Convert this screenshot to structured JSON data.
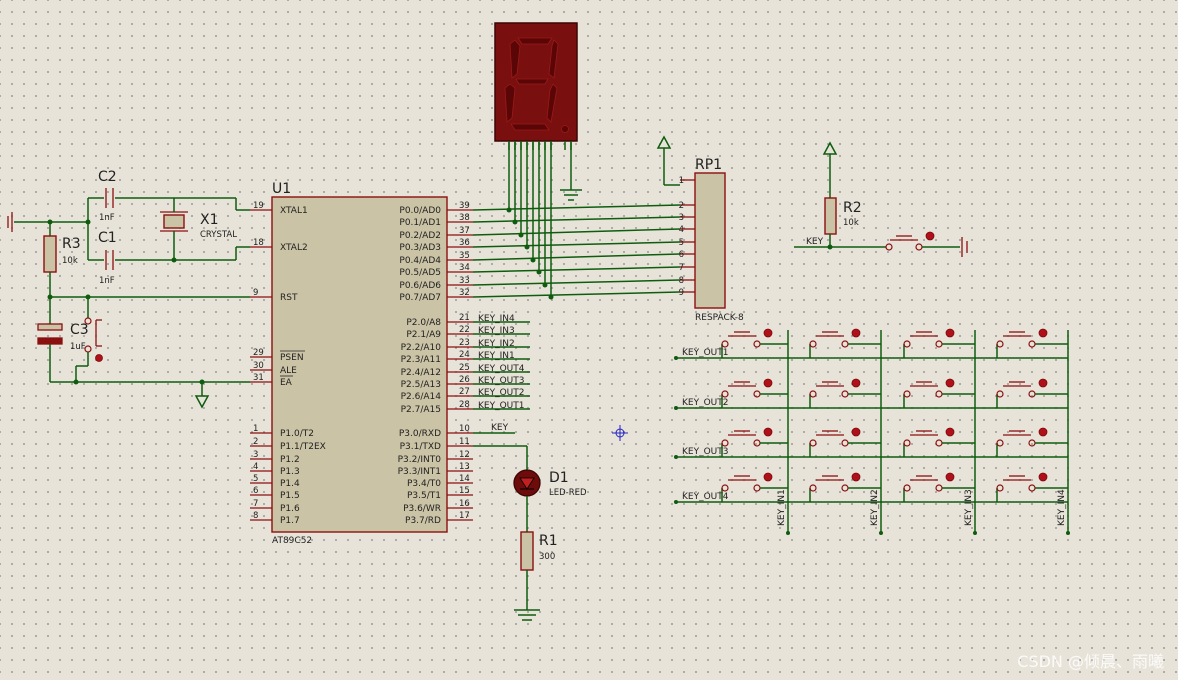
{
  "u1": {
    "ref": "U1",
    "part": "AT89C52",
    "left_pins": [
      {
        "num": "19",
        "name": "XTAL1"
      },
      {
        "num": "18",
        "name": "XTAL2"
      },
      {
        "num": "9",
        "name": "RST"
      },
      {
        "num": "29",
        "name": "PSEN"
      },
      {
        "num": "30",
        "name": "ALE"
      },
      {
        "num": "31",
        "name": "EA"
      },
      {
        "num": "1",
        "name": "P1.0/T2"
      },
      {
        "num": "2",
        "name": "P1.1/T2EX"
      },
      {
        "num": "3",
        "name": "P1.2"
      },
      {
        "num": "4",
        "name": "P1.3"
      },
      {
        "num": "5",
        "name": "P1.4"
      },
      {
        "num": "6",
        "name": "P1.5"
      },
      {
        "num": "7",
        "name": "P1.6"
      },
      {
        "num": "8",
        "name": "P1.7"
      }
    ],
    "right_pins": [
      {
        "num": "39",
        "name": "P0.0/AD0"
      },
      {
        "num": "38",
        "name": "P0.1/AD1"
      },
      {
        "num": "37",
        "name": "P0.2/AD2"
      },
      {
        "num": "36",
        "name": "P0.3/AD3"
      },
      {
        "num": "35",
        "name": "P0.4/AD4"
      },
      {
        "num": "34",
        "name": "P0.5/AD5"
      },
      {
        "num": "33",
        "name": "P0.6/AD6"
      },
      {
        "num": "32",
        "name": "P0.7/AD7"
      },
      {
        "num": "21",
        "name": "P2.0/A8"
      },
      {
        "num": "22",
        "name": "P2.1/A9"
      },
      {
        "num": "23",
        "name": "P2.2/A10"
      },
      {
        "num": "24",
        "name": "P2.3/A11"
      },
      {
        "num": "25",
        "name": "P2.4/A12"
      },
      {
        "num": "26",
        "name": "P2.5/A13"
      },
      {
        "num": "27",
        "name": "P2.6/A14"
      },
      {
        "num": "28",
        "name": "P2.7/A15"
      },
      {
        "num": "10",
        "name": "P3.0/RXD"
      },
      {
        "num": "11",
        "name": "P3.1/TXD"
      },
      {
        "num": "12",
        "name": "P3.2/INT0"
      },
      {
        "num": "13",
        "name": "P3.3/INT1"
      },
      {
        "num": "14",
        "name": "P3.4/T0"
      },
      {
        "num": "15",
        "name": "P3.5/T1"
      },
      {
        "num": "16",
        "name": "P3.6/WR"
      },
      {
        "num": "17",
        "name": "P3.7/RD"
      }
    ],
    "p2_nets": [
      "KEY_IN4",
      "KEY_IN3",
      "KEY_IN2",
      "KEY_IN1",
      "KEY_OUT4",
      "KEY_OUT3",
      "KEY_OUT2",
      "KEY_OUT1"
    ],
    "p3_net": "KEY"
  },
  "c2": {
    "ref": "C2",
    "value": "1nF"
  },
  "c1": {
    "ref": "C1",
    "value": "1nF"
  },
  "x1": {
    "ref": "X1",
    "value": "CRYSTAL"
  },
  "r3": {
    "ref": "R3",
    "value": "10k"
  },
  "c3": {
    "ref": "C3",
    "value": "1uF"
  },
  "rp1": {
    "ref": "RP1",
    "part": "RESPACK-8",
    "pins": [
      "1",
      "2",
      "3",
      "4",
      "5",
      "6",
      "7",
      "8",
      "9"
    ]
  },
  "r2": {
    "ref": "R2",
    "value": "10k",
    "net": "KEY"
  },
  "d1": {
    "ref": "D1",
    "value": "LED-RED"
  },
  "r1": {
    "ref": "R1",
    "value": "300"
  },
  "keypad": {
    "rows": [
      "KEY_OUT1",
      "KEY_OUT2",
      "KEY_OUT3",
      "KEY_OUT4"
    ],
    "cols": [
      "KEY_IN1",
      "KEY_IN2",
      "KEY_IN3",
      "KEY_IN4"
    ]
  },
  "watermark": "CSDN @倾晨、雨曦",
  "colors": {
    "wire": "#0e5c0e",
    "pin": "#8b1010",
    "body": "#cbc3a6",
    "display_bg": "#7a0f0f",
    "display_seg": "#5a0606"
  }
}
